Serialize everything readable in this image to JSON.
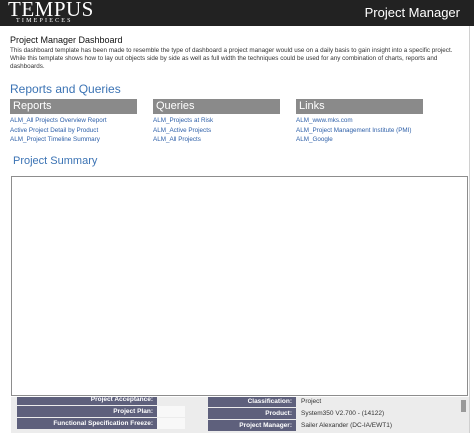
{
  "header": {
    "logo_main": "TEMPUS",
    "logo_sub": "TIMEPIECES",
    "title": "Project Manager"
  },
  "dashboard": {
    "title": "Project Manager Dashboard",
    "description": "This dashboard template has been made to resemble the type of dashboard a project manager would use on a daily basis to gain insight into a specific project. While this template shows how to lay out objects side by side as well as full width the techniques could be used for any combination of charts, reports and dashboards."
  },
  "sections": {
    "reports_queries": "Reports and Queries",
    "columns": [
      {
        "title": "Reports",
        "links": [
          "ALM_All Projects Overview Report",
          "Active Project Detail by Product",
          "ALM_Project Timeline Summary"
        ]
      },
      {
        "title": "Queries",
        "links": [
          "ALM_Projects at Risk",
          "ALM_Active Projects",
          "ALM_All Projects"
        ]
      },
      {
        "title": "Links",
        "links": [
          "ALM_www.mks.com",
          "ALM_Project Management Institute (PMI)",
          "ALM_Google"
        ]
      }
    ],
    "summary": "Project Summary"
  },
  "summary_fields": {
    "left": [
      {
        "label": "Project Acceptance:"
      },
      {
        "label": "Project Plan:"
      },
      {
        "label": "Functional Specification Freeze:"
      }
    ],
    "right": [
      {
        "label": "Classification:",
        "value": "Project"
      },
      {
        "label": "Product:",
        "value": "System350 V2.700 - (14122)"
      },
      {
        "label": "Project Manager:",
        "value": "Sailer Alexander (DC-IA/EWT1)"
      }
    ]
  }
}
